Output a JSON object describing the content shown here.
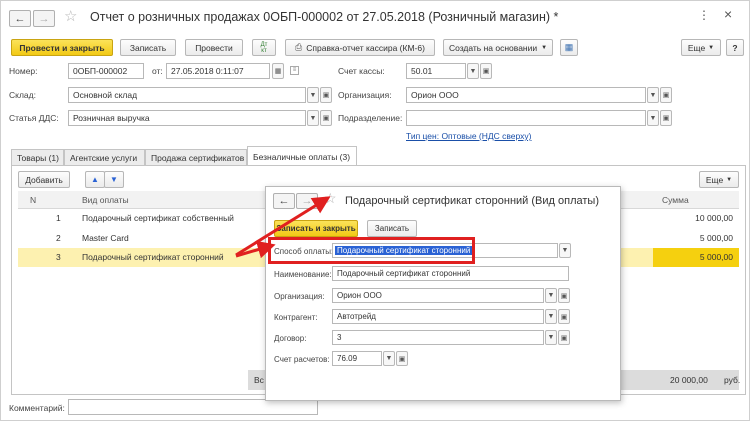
{
  "window": {
    "title": "Отчет о розничных продажах 0ОБП-000002 от 27.05.2018 (Розничный магазин) *",
    "menu_icon": "more-vertical-icon",
    "close_icon": "close-icon"
  },
  "toolbar": {
    "post_close": "Провести и закрыть",
    "save": "Записать",
    "post": "Провести",
    "dt_kt": "Дт\nкт",
    "cashier_report": "Справка-отчет кассира (КМ-6)",
    "create_based_on": "Создать на основании",
    "more": "Еще",
    "help": "?"
  },
  "form": {
    "number_label": "Номер:",
    "number_value": "0ОБП-000002",
    "date_label": "от:",
    "date_value": "27.05.2018  0:11:07",
    "account_label": "Счет кассы:",
    "account_value": "50.01",
    "warehouse_label": "Склад:",
    "warehouse_value": "Основной склад",
    "org_label": "Организация:",
    "org_value": "Орион ООО",
    "dds_label": "Статья ДДС:",
    "dds_value": "Розничная выручка",
    "division_label": "Подразделение:",
    "division_value": "",
    "price_type_link": "Тип цен: Оптовые (НДС сверху)",
    "comment_label": "Комментарий:",
    "comment_value": ""
  },
  "tabs": [
    {
      "label": "Товары (1)"
    },
    {
      "label": "Агентские услуги"
    },
    {
      "label": "Продажа сертификатов"
    },
    {
      "label": "Безналичные оплаты (3)"
    }
  ],
  "table": {
    "add_button": "Добавить",
    "more_button": "Еще",
    "headers": {
      "n": "N",
      "type": "Вид оплаты",
      "sum": "Сумма"
    },
    "rows": [
      {
        "n": "1",
        "type": "Подарочный сертификат собственный",
        "sum": "10 000,00"
      },
      {
        "n": "2",
        "type": "Master Card",
        "sum": "5 000,00"
      },
      {
        "n": "3",
        "type": "Подарочный сертификат сторонний",
        "sum": "5 000,00"
      }
    ],
    "total_label_partial": "Вс",
    "total_value": "20 000,00",
    "currency": "руб."
  },
  "dialog": {
    "title": "Подарочный сертификат сторонний (Вид оплаты)",
    "save_close": "Записать и закрыть",
    "save": "Записать",
    "payment_method_label": "Способ оплаты:",
    "payment_method_value": "Подарочный сертификат сторонний",
    "name_label": "Наименование:",
    "name_value": "Подарочный сертификат сторонний",
    "org_label": "Организация:",
    "org_value": "Орион ООО",
    "counterparty_label": "Контрагент:",
    "counterparty_value": "Автотрейд",
    "contract_label": "Договор:",
    "contract_value": "3",
    "account_label": "Счет расчетов:",
    "account_value": "76.09"
  },
  "colors": {
    "primary_button": "#f2c915",
    "selected_row": "#fdf1b0",
    "selected_sum": "#f5d00f",
    "link": "#1a4fa8",
    "annotation_red": "#e02020",
    "selection_blue": "#2a62d4"
  }
}
